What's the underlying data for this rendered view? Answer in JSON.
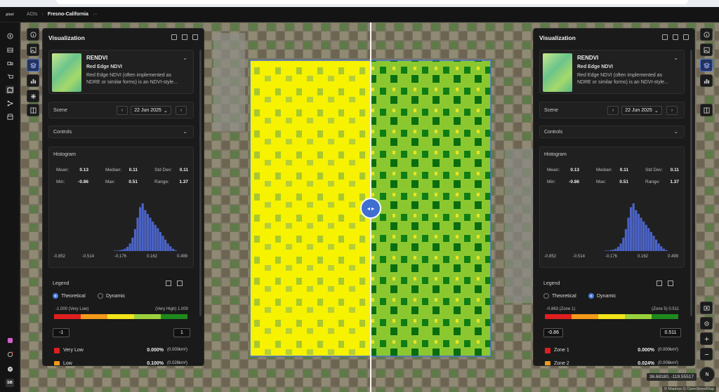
{
  "breadcrumb": {
    "root": "AOIs",
    "current": "Fresno-California",
    "more": "···"
  },
  "logo_text": "pixel",
  "user_initials": "SB",
  "panels": [
    {
      "title": "Visualization",
      "layer": {
        "name": "RENDVI",
        "subtitle": "Red Edge NDVI",
        "description": "Red Edge NDVI (often implemented as NDRE or similar forms) is an NDVI-style..."
      },
      "scene": {
        "label": "Scene",
        "date": "22 Jun 2025"
      },
      "controls": {
        "label": "Controls"
      },
      "histogram": {
        "label": "Histogram",
        "stats": {
          "mean_label": "Mean:",
          "mean": "0.13",
          "median_label": "Median:",
          "median": "0.11",
          "std_label": "Std Dev:",
          "std": "0.11",
          "min_label": "Min:",
          "min": "-0.86",
          "max_label": "Max:",
          "max": "0.51",
          "range_label": "Range:",
          "range": "1.37"
        },
        "ticks": [
          "-0.852",
          "-0.514",
          "-0.176",
          "0.162",
          "0.499"
        ]
      },
      "legend": {
        "label": "Legend",
        "mode_a": "Theoretical",
        "mode_b": "Dynamic",
        "selected": "Theoretical",
        "range_low": "-1.000 (Very Low)",
        "range_high": "(Very High) 1.000",
        "min_value": "-1",
        "max_value": "1",
        "rows": [
          {
            "name": "Very Low",
            "pct": "0.000%",
            "area": "(0.000km²)",
            "color": "#e01e1e"
          },
          {
            "name": "Low",
            "pct": "0.100%",
            "area": "(0.026km²)",
            "color": "#f29a1a"
          }
        ]
      }
    },
    {
      "title": "Visualization",
      "layer": {
        "name": "RENDVI",
        "subtitle": "Red Edge NDVI",
        "description": "Red Edge NDVI (often implemented as NDRE or similar forms) is an NDVI-style..."
      },
      "scene": {
        "label": "Scene",
        "date": "22 Jun 2025"
      },
      "controls": {
        "label": "Controls"
      },
      "histogram": {
        "label": "Histogram",
        "stats": {
          "mean_label": "Mean:",
          "mean": "0.13",
          "median_label": "Median:",
          "median": "0.11",
          "std_label": "Std Dev:",
          "std": "0.11",
          "min_label": "Min:",
          "min": "-0.86",
          "max_label": "Max:",
          "max": "0.51",
          "range_label": "Range:",
          "range": "1.37"
        },
        "ticks": [
          "-0.852",
          "-0.514",
          "-0.176",
          "0.162",
          "0.499"
        ]
      },
      "legend": {
        "label": "Legend",
        "mode_a": "Theoretical",
        "mode_b": "Dynamic",
        "selected": "Dynamic",
        "range_low": "-0.863 (Zone 1)",
        "range_high": "(Zone 5) 0.511",
        "min_value": "-0.86",
        "max_value": "0.511",
        "rows": [
          {
            "name": "Zone 1",
            "pct": "0.000%",
            "area": "(0.000km²)",
            "color": "#e01e1e"
          },
          {
            "name": "Zone 2",
            "pct": "0.024%",
            "area": "(0.006km²)",
            "color": "#f29a1a"
          }
        ]
      }
    }
  ],
  "ramp_colors": [
    "#e01e1e",
    "#f29a1a",
    "#f2e41a",
    "#9bd23c",
    "#1e8a1e"
  ],
  "histogram_bars": [
    1,
    1,
    2,
    3,
    5,
    9,
    16,
    28,
    46,
    70,
    92,
    100,
    86,
    78,
    70,
    62,
    55,
    48,
    40,
    32,
    24,
    16,
    10,
    5,
    2
  ],
  "map": {
    "coords": "36.68180, -119.55517",
    "attribution": "© Mapbox © OpenStreetMap",
    "compass": "N"
  },
  "colors": {
    "accent": "#3e6fd1",
    "ndvi_left": "#f6f200",
    "ndvi_right": "#8bc830"
  }
}
